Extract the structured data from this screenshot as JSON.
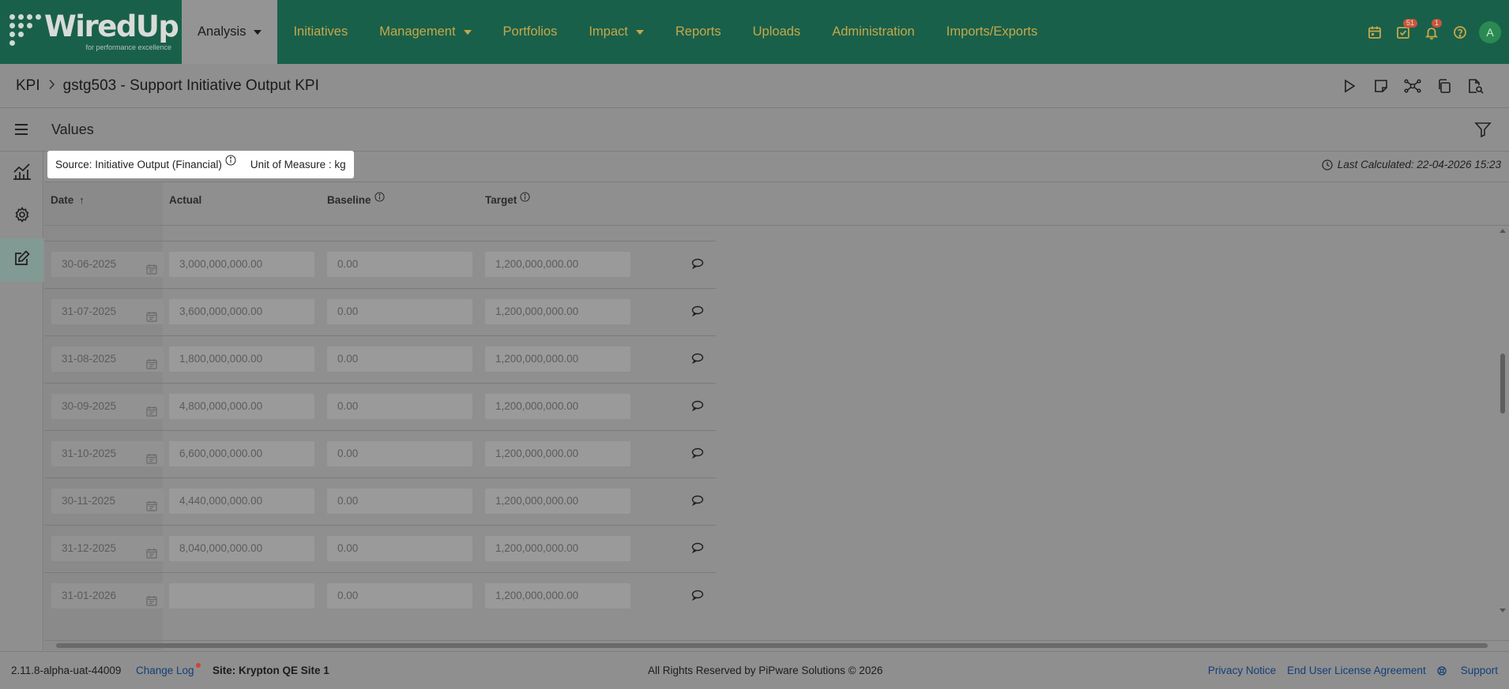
{
  "nav": {
    "logo_text": "WiredUp",
    "logo_tagline": "for performance excellence",
    "items": [
      {
        "label": "Analysis",
        "has_dropdown": true,
        "active": true
      },
      {
        "label": "Initiatives",
        "has_dropdown": false
      },
      {
        "label": "Management",
        "has_dropdown": true
      },
      {
        "label": "Portfolios",
        "has_dropdown": false
      },
      {
        "label": "Impact",
        "has_dropdown": true
      },
      {
        "label": "Reports",
        "has_dropdown": false
      },
      {
        "label": "Uploads",
        "has_dropdown": false
      },
      {
        "label": "Administration",
        "has_dropdown": false
      },
      {
        "label": "Imports/Exports",
        "has_dropdown": false
      }
    ],
    "tasks_badge": "51",
    "notifications_badge": "1",
    "avatar_initial": "A",
    "icons": [
      "calendar-icon",
      "tasks-icon",
      "bell-icon",
      "help-icon"
    ]
  },
  "breadcrumb": {
    "root": "KPI",
    "current": "gstg503 - Support Initiative Output KPI"
  },
  "toolbar_icons": [
    "play-icon",
    "note-icon",
    "network-icon",
    "copy-icon",
    "preview-icon"
  ],
  "values_header": {
    "title": "Values"
  },
  "info": {
    "source": "Source: Initiative Output (Financial)",
    "unit": "Unit of Measure : kg",
    "last_calculated": "Last Calculated: 22-04-2026 15:23"
  },
  "columns": {
    "date": "Date",
    "actual": "Actual",
    "baseline": "Baseline",
    "target": "Target",
    "sort_indicator": "↑"
  },
  "rows": [
    {
      "date": "30-06-2025",
      "actual": "3,000,000,000.00",
      "baseline": "0.00",
      "target": "1,200,000,000.00"
    },
    {
      "date": "31-07-2025",
      "actual": "3,600,000,000.00",
      "baseline": "0.00",
      "target": "1,200,000,000.00"
    },
    {
      "date": "31-08-2025",
      "actual": "1,800,000,000.00",
      "baseline": "0.00",
      "target": "1,200,000,000.00"
    },
    {
      "date": "30-09-2025",
      "actual": "4,800,000,000.00",
      "baseline": "0.00",
      "target": "1,200,000,000.00"
    },
    {
      "date": "31-10-2025",
      "actual": "6,600,000,000.00",
      "baseline": "0.00",
      "target": "1,200,000,000.00"
    },
    {
      "date": "30-11-2025",
      "actual": "4,440,000,000.00",
      "baseline": "0.00",
      "target": "1,200,000,000.00"
    },
    {
      "date": "31-12-2025",
      "actual": "8,040,000,000.00",
      "baseline": "0.00",
      "target": "1,200,000,000.00"
    },
    {
      "date": "31-01-2026",
      "actual": "",
      "baseline": "0.00",
      "target": "1,200,000,000.00"
    }
  ],
  "footer": {
    "version": "2.11.8-alpha-uat-44009",
    "change_log": "Change Log",
    "site": "Site: Krypton QE Site 1",
    "rights": "All Rights Reserved by PiPware Solutions © 2026",
    "privacy": "Privacy Notice",
    "eula": "End User License Agreement",
    "support": "Support"
  },
  "colors": {
    "nav_bg": "#19604a",
    "nav_text": "#c5a84a",
    "overlay_bg": "#8f8f8f",
    "link": "#123f7a",
    "badge": "#c9553e"
  }
}
